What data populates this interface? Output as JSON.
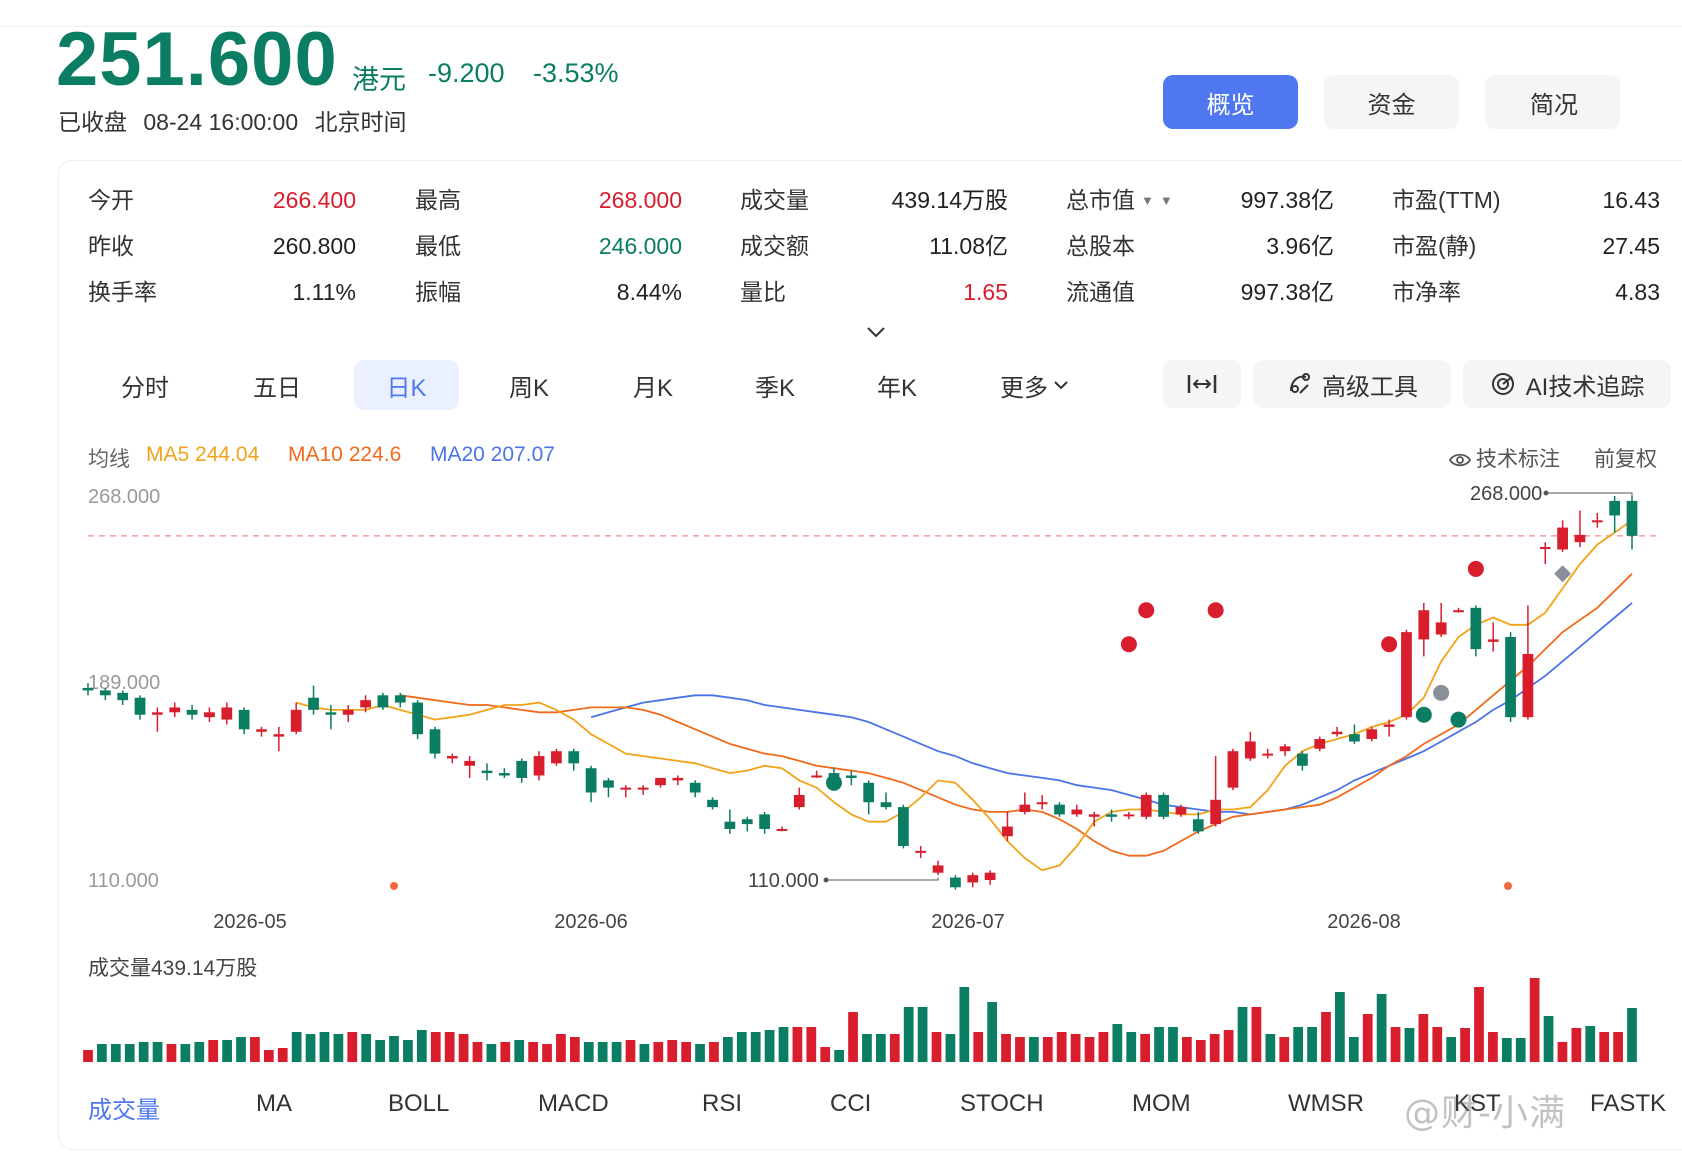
{
  "header": {
    "price": "251.600",
    "currency": "港元",
    "change": "-9.200",
    "change_pct": "-3.53%",
    "status": "已收盘",
    "datetime": "08-24 16:00:00",
    "timezone": "北京时间",
    "tabs": [
      "概览",
      "资金",
      "简况"
    ],
    "accent_color": "#4f78f0",
    "down_color": "#0b7d63",
    "up_color": "#d81e2c"
  },
  "quote": {
    "rows": [
      [
        {
          "label": "今开",
          "value": "266.400",
          "color": "up"
        },
        {
          "label": "最高",
          "value": "268.000",
          "color": "up"
        },
        {
          "label": "成交量",
          "value": "439.14万股",
          "color": ""
        },
        {
          "label": "总市值",
          "value": "997.38亿",
          "color": ""
        },
        {
          "label": "市盈(TTM)",
          "value": "16.43",
          "color": ""
        }
      ],
      [
        {
          "label": "昨收",
          "value": "260.800",
          "color": ""
        },
        {
          "label": "最低",
          "value": "246.000",
          "color": "down"
        },
        {
          "label": "成交额",
          "value": "11.08亿",
          "color": ""
        },
        {
          "label": "总股本",
          "value": "3.96亿",
          "color": ""
        },
        {
          "label": "市盈(静)",
          "value": "27.45",
          "color": ""
        }
      ],
      [
        {
          "label": "换手率",
          "value": "1.11%",
          "color": ""
        },
        {
          "label": "振幅",
          "value": "8.44%",
          "color": ""
        },
        {
          "label": "量比",
          "value": "1.65",
          "color": "up"
        },
        {
          "label": "流通值",
          "value": "997.38亿",
          "color": ""
        },
        {
          "label": "市净率",
          "value": "4.83",
          "color": ""
        }
      ]
    ]
  },
  "period_tabs": [
    "分时",
    "五日",
    "日K",
    "周K",
    "月K",
    "季K",
    "年K",
    "更多"
  ],
  "active_period": "日K",
  "tools": {
    "fit": "",
    "advanced": "高级工具",
    "ai": "AI技术追踪"
  },
  "ma": {
    "label": "均线",
    "ma5": "MA5 244.04",
    "ma10": "MA10 224.6",
    "ma20": "MA20 207.07",
    "ma5_color": "#f2a319",
    "ma10_color": "#f26a1b",
    "ma20_color": "#4a74e8"
  },
  "chart_links": {
    "mark": "技术标注",
    "adjust": "前复权"
  },
  "chart_data": {
    "type": "candlestick",
    "y_labels": [
      "268.000",
      "189.000",
      "110.000"
    ],
    "ylim": [
      110,
      268
    ],
    "x_labels": [
      "2026-05",
      "2026-06",
      "2026-07",
      "2026-08"
    ],
    "high_annotation": "268.000",
    "low_annotation": "110.000",
    "reference_line": 251.6,
    "candles": [
      {
        "o": 189,
        "c": 188,
        "h": 191,
        "l": 186
      },
      {
        "o": 188,
        "c": 186,
        "h": 189,
        "l": 184
      },
      {
        "o": 187,
        "c": 184,
        "h": 188,
        "l": 182
      },
      {
        "o": 185,
        "c": 178,
        "h": 186,
        "l": 176
      },
      {
        "o": 178,
        "c": 179,
        "h": 181,
        "l": 171
      },
      {
        "o": 179,
        "c": 181,
        "h": 183,
        "l": 177
      },
      {
        "o": 180,
        "c": 178,
        "h": 182,
        "l": 176
      },
      {
        "o": 177,
        "c": 179,
        "h": 181,
        "l": 175
      },
      {
        "o": 176,
        "c": 181,
        "h": 183,
        "l": 174
      },
      {
        "o": 180,
        "c": 172,
        "h": 181,
        "l": 170
      },
      {
        "o": 171,
        "c": 172,
        "h": 173,
        "l": 169
      },
      {
        "o": 169,
        "c": 170,
        "h": 173,
        "l": 163
      },
      {
        "o": 171,
        "c": 180,
        "h": 183,
        "l": 170
      },
      {
        "o": 185,
        "c": 180,
        "h": 190,
        "l": 178
      },
      {
        "o": 179,
        "c": 178,
        "h": 182,
        "l": 172
      },
      {
        "o": 178,
        "c": 180,
        "h": 182,
        "l": 175
      },
      {
        "o": 181,
        "c": 184,
        "h": 186,
        "l": 179
      },
      {
        "o": 186,
        "c": 181,
        "h": 187,
        "l": 180
      },
      {
        "o": 186,
        "c": 183,
        "h": 187,
        "l": 181
      },
      {
        "o": 183,
        "c": 170,
        "h": 184,
        "l": 168
      },
      {
        "o": 172,
        "c": 162,
        "h": 173,
        "l": 160
      },
      {
        "o": 160,
        "c": 161,
        "h": 162,
        "l": 158
      },
      {
        "o": 157,
        "c": 159,
        "h": 161,
        "l": 152
      },
      {
        "o": 155,
        "c": 154,
        "h": 158,
        "l": 151
      },
      {
        "o": 154,
        "c": 153,
        "h": 156,
        "l": 152
      },
      {
        "o": 159,
        "c": 152,
        "h": 160,
        "l": 150
      },
      {
        "o": 153,
        "c": 161,
        "h": 163,
        "l": 151
      },
      {
        "o": 158,
        "c": 163,
        "h": 164,
        "l": 157
      },
      {
        "o": 163,
        "c": 158,
        "h": 164,
        "l": 155
      },
      {
        "o": 156,
        "c": 146,
        "h": 157,
        "l": 142
      },
      {
        "o": 151,
        "c": 148,
        "h": 152,
        "l": 144
      },
      {
        "o": 148,
        "c": 148,
        "h": 149,
        "l": 144
      },
      {
        "o": 148,
        "c": 148,
        "h": 149,
        "l": 145
      },
      {
        "o": 149,
        "c": 152,
        "h": 152,
        "l": 148
      },
      {
        "o": 151,
        "c": 152,
        "h": 153,
        "l": 149
      },
      {
        "o": 150,
        "c": 146,
        "h": 151,
        "l": 144
      },
      {
        "o": 143,
        "c": 140,
        "h": 144,
        "l": 139
      },
      {
        "o": 134,
        "c": 131,
        "h": 139,
        "l": 129
      },
      {
        "o": 135,
        "c": 133,
        "h": 136,
        "l": 130
      },
      {
        "o": 137,
        "c": 131,
        "h": 138,
        "l": 129
      },
      {
        "o": 131,
        "c": 131,
        "h": 132,
        "l": 130
      },
      {
        "o": 140,
        "c": 145,
        "h": 148,
        "l": 139
      },
      {
        "o": 153,
        "c": 153,
        "h": 155,
        "l": 152
      },
      {
        "o": 154,
        "c": 151,
        "h": 156,
        "l": 150
      },
      {
        "o": 153,
        "c": 152,
        "h": 155,
        "l": 149
      },
      {
        "o": 150,
        "c": 142,
        "h": 151,
        "l": 137
      },
      {
        "o": 142,
        "c": 140,
        "h": 146,
        "l": 139
      },
      {
        "o": 140,
        "c": 124,
        "h": 141,
        "l": 123
      },
      {
        "o": 122,
        "c": 122,
        "h": 124,
        "l": 119
      },
      {
        "o": 113,
        "c": 116,
        "h": 118,
        "l": 112
      },
      {
        "o": 111,
        "c": 107,
        "h": 112,
        "l": 106
      },
      {
        "o": 109,
        "c": 112,
        "h": 113,
        "l": 107
      },
      {
        "o": 110,
        "c": 113,
        "h": 114,
        "l": 108
      },
      {
        "o": 128,
        "c": 132,
        "h": 138,
        "l": 126
      },
      {
        "o": 138,
        "c": 141,
        "h": 146,
        "l": 137
      },
      {
        "o": 142,
        "c": 142,
        "h": 145,
        "l": 139
      },
      {
        "o": 141,
        "c": 137,
        "h": 142,
        "l": 136
      },
      {
        "o": 137,
        "c": 139,
        "h": 141,
        "l": 136
      },
      {
        "o": 136,
        "c": 137,
        "h": 138,
        "l": 132
      },
      {
        "o": 137,
        "c": 136,
        "h": 139,
        "l": 134
      },
      {
        "o": 137,
        "c": 137,
        "h": 138,
        "l": 135
      },
      {
        "o": 136,
        "c": 145,
        "h": 146,
        "l": 135
      },
      {
        "o": 145,
        "c": 136,
        "h": 146,
        "l": 135
      },
      {
        "o": 137,
        "c": 140,
        "h": 141,
        "l": 136
      },
      {
        "o": 135,
        "c": 130,
        "h": 138,
        "l": 129
      },
      {
        "o": 133,
        "c": 143,
        "h": 161,
        "l": 132
      },
      {
        "o": 148,
        "c": 163,
        "h": 164,
        "l": 147
      },
      {
        "o": 160,
        "c": 167,
        "h": 171,
        "l": 159
      },
      {
        "o": 162,
        "c": 162,
        "h": 164,
        "l": 160
      },
      {
        "o": 163,
        "c": 165,
        "h": 166,
        "l": 161
      },
      {
        "o": 162,
        "c": 157,
        "h": 163,
        "l": 155
      },
      {
        "o": 164,
        "c": 168,
        "h": 169,
        "l": 163
      },
      {
        "o": 170,
        "c": 171,
        "h": 173,
        "l": 169
      },
      {
        "o": 170,
        "c": 167,
        "h": 174,
        "l": 166
      },
      {
        "o": 168,
        "c": 172,
        "h": 173,
        "l": 167
      },
      {
        "o": 173,
        "c": 174,
        "h": 176,
        "l": 169
      },
      {
        "o": 177,
        "c": 212,
        "h": 213,
        "l": 176
      },
      {
        "o": 209,
        "c": 221,
        "h": 224,
        "l": 202
      },
      {
        "o": 211,
        "c": 216,
        "h": 224,
        "l": 210
      },
      {
        "o": 221,
        "c": 221,
        "h": 222,
        "l": 220
      },
      {
        "o": 222,
        "c": 205,
        "h": 223,
        "l": 202
      },
      {
        "o": 208,
        "c": 209,
        "h": 216,
        "l": 204
      },
      {
        "o": 210,
        "c": 177,
        "h": 212,
        "l": 175
      },
      {
        "o": 177,
        "c": 203,
        "h": 223,
        "l": 176
      },
      {
        "o": 247,
        "c": 247,
        "h": 249,
        "l": 240
      },
      {
        "o": 246,
        "c": 255,
        "h": 258,
        "l": 245
      },
      {
        "o": 249,
        "c": 252,
        "h": 262,
        "l": 247
      },
      {
        "o": 258,
        "c": 258,
        "h": 261,
        "l": 255
      },
      {
        "o": 266,
        "c": 260,
        "h": 268,
        "l": 253
      },
      {
        "o": 266,
        "c": 251.6,
        "h": 268,
        "l": 246
      }
    ],
    "ma5": [
      183,
      181,
      180,
      180,
      180,
      182,
      180,
      178,
      176,
      177,
      178,
      180,
      182,
      182,
      183,
      180,
      176,
      170,
      166,
      162,
      161,
      160,
      159,
      158,
      156,
      154,
      155,
      157,
      156,
      151,
      148,
      142,
      137,
      134,
      134,
      138,
      144,
      151,
      150,
      143,
      135,
      126,
      119,
      114,
      116,
      124,
      134,
      138,
      139,
      139,
      138,
      137,
      137,
      139,
      139,
      140,
      147,
      157,
      163,
      166,
      168,
      170,
      173,
      175,
      178,
      185,
      200,
      210,
      215,
      218,
      215,
      215,
      220,
      230,
      240,
      248,
      253,
      258
    ],
    "ma10": [
      186,
      185,
      184,
      183,
      182,
      182,
      181,
      180,
      179,
      179,
      180,
      181,
      181,
      181,
      180,
      178,
      175,
      172,
      169,
      166,
      164,
      162,
      161,
      159,
      157,
      156,
      155,
      154,
      152,
      150,
      147,
      144,
      141,
      139,
      138,
      138,
      139,
      138,
      135,
      131,
      126,
      122,
      120,
      120,
      122,
      126,
      130,
      133,
      136,
      137,
      138,
      139,
      140,
      141,
      144,
      148,
      152,
      157,
      161,
      166,
      170,
      174,
      180,
      186,
      192,
      198,
      205,
      212,
      217,
      222,
      229,
      236
    ],
    "ma20": [
      177,
      179,
      181,
      183,
      184,
      185,
      186,
      186,
      185,
      184,
      182,
      181,
      180,
      179,
      178,
      177,
      175,
      172,
      169,
      166,
      163,
      161,
      158,
      156,
      154,
      153,
      152,
      151,
      149,
      148,
      147,
      145,
      143,
      141,
      140,
      139,
      138,
      138,
      137,
      138,
      139,
      141,
      144,
      147,
      151,
      154,
      157,
      160,
      163,
      167,
      171,
      175,
      180,
      184,
      189,
      194,
      200,
      206,
      212,
      218,
      224
    ]
  },
  "volume": {
    "label": "成交量439.14万股",
    "bars": [
      12,
      18,
      18,
      18,
      20,
      20,
      18,
      18,
      20,
      22,
      22,
      25,
      25,
      12,
      14,
      30,
      28,
      30,
      28,
      30,
      28,
      22,
      26,
      22,
      32,
      30,
      30,
      28,
      20,
      18,
      20,
      22,
      20,
      18,
      28,
      25,
      20,
      20,
      20,
      22,
      18,
      20,
      22,
      20,
      18,
      20,
      25,
      30,
      30,
      32,
      35,
      35,
      35,
      15,
      12,
      50,
      28,
      28,
      28,
      55,
      55,
      30,
      28,
      75,
      30,
      60,
      28,
      25,
      25,
      25,
      30,
      28,
      25,
      30,
      38,
      30,
      28,
      35,
      35,
      25,
      22,
      28,
      32,
      55,
      55,
      28,
      25,
      35,
      35,
      50,
      70,
      25,
      48,
      68,
      35,
      34,
      48,
      35,
      25,
      34,
      75,
      30,
      24,
      24,
      84,
      46,
      20,
      34,
      36,
      30,
      30,
      54
    ]
  },
  "indicator_tabs": [
    "成交量",
    "MA",
    "BOLL",
    "MACD",
    "RSI",
    "CCI",
    "STOCH",
    "MOM",
    "WMSR",
    "KST",
    "FASTK"
  ],
  "watermark": "@财-小满"
}
